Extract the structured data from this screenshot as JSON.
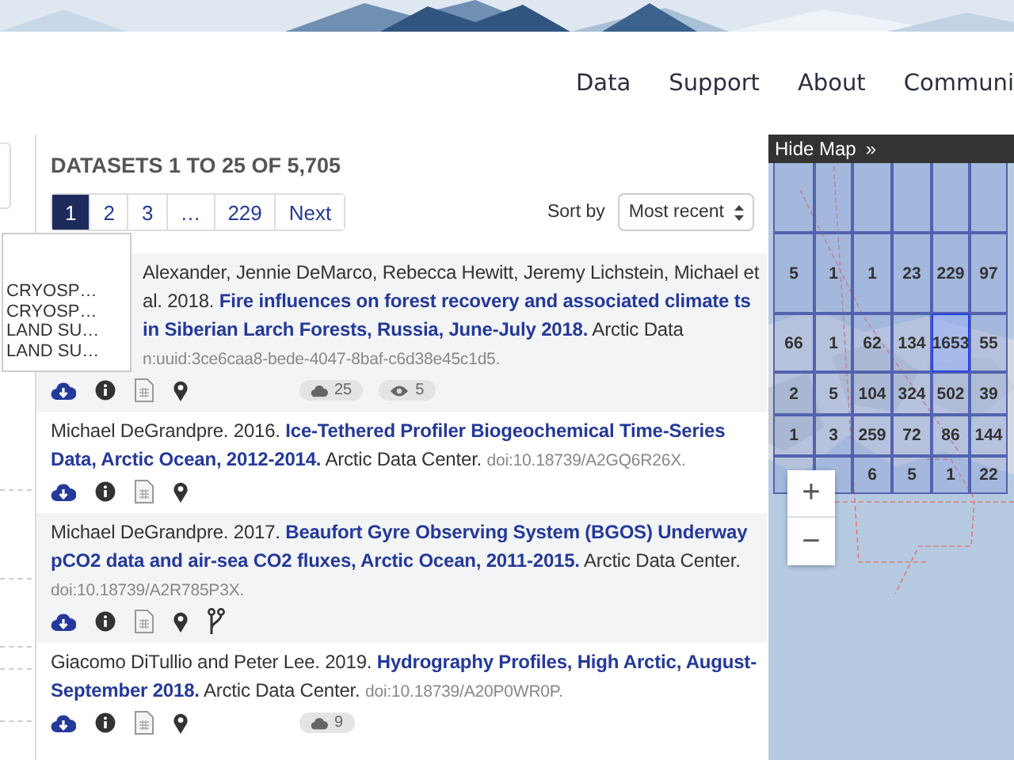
{
  "nav": {
    "items": [
      "Data",
      "Support",
      "About",
      "Communi"
    ]
  },
  "results": {
    "heading": "DATASETS 1 TO 25 OF 5,705",
    "pagination": [
      {
        "label": "1",
        "selected": true
      },
      {
        "label": "2",
        "selected": false
      },
      {
        "label": "3",
        "selected": false
      },
      {
        "label": "…",
        "selected": false
      },
      {
        "label": "229",
        "selected": false
      },
      {
        "label": "Next",
        "selected": false
      }
    ],
    "sort": {
      "label": "Sort by",
      "value": "Most recent"
    },
    "items": [
      {
        "citation": "Alexander, Jennie DeMarco, Rebecca Hewitt, Jeremy Lichstein, Michael et al. 2018. **Fire influences on forest recovery and associated climate ts in Siberian Larch Forests, Russia, June-July 2018.** Arctic Data",
        "id": "n:uuid:3ce6caa8-bede-4047-8baf-c6d38e45c1d5.",
        "partly_covered": true,
        "has_branch": false,
        "downloads": "25",
        "views": "5"
      },
      {
        "citation": "Michael DeGrandpre. 2016. **Ice-Tethered Profiler Biogeochemical Time-Series Data, Arctic Ocean, 2012-2014.** Arctic Data Center.",
        "id": "doi:10.18739/A2GQ6R26X.",
        "partly_covered": false,
        "has_branch": false
      },
      {
        "citation": "Michael DeGrandpre. 2017. **Beaufort Gyre Observing System (BGOS) Underway pCO2 data and air-sea CO2 fluxes, Arctic Ocean, 2011-2015.** Arctic Data Center.",
        "id": "doi:10.18739/A2R785P3X.",
        "partly_covered": false,
        "has_branch": true
      },
      {
        "citation": "Giacomo DiTullio and Peter Lee. 2019. **Hydrography Profiles, High Arctic, August-September 2018.** Arctic Data Center.",
        "id": "doi:10.18739/A20P0WR0P.",
        "partly_covered": false,
        "has_branch": false,
        "downloads": "9"
      }
    ]
  },
  "filter_popup": {
    "items": [
      "CRYOSP…",
      "CRYOSP…",
      "LAND SU…",
      "LAND SU…"
    ]
  },
  "map": {
    "toggle": "Hide Map",
    "toggle_icon": "»",
    "rows": [
      [
        {
          "count": "5",
          "selected": false
        },
        {
          "count": "1",
          "selected": false
        },
        {
          "count": "1",
          "selected": false
        },
        {
          "count": "23",
          "selected": false
        },
        {
          "count": "229",
          "selected": false
        },
        {
          "count": "97",
          "selected": false
        }
      ],
      [
        {
          "count": "66",
          "selected": false
        },
        {
          "count": "1",
          "selected": false
        },
        {
          "count": "62",
          "selected": false
        },
        {
          "count": "134",
          "selected": false
        },
        {
          "count": "1653",
          "selected": true
        },
        {
          "count": "55",
          "selected": false
        }
      ],
      [
        {
          "count": "2",
          "selected": false
        },
        {
          "count": "5",
          "selected": false
        },
        {
          "count": "104",
          "selected": false
        },
        {
          "count": "324",
          "selected": false
        },
        {
          "count": "502",
          "selected": false
        },
        {
          "count": "39",
          "selected": false
        }
      ],
      [
        {
          "count": "1",
          "selected": false
        },
        {
          "count": "3",
          "selected": false
        },
        {
          "count": "259",
          "selected": false
        },
        {
          "count": "72",
          "selected": false
        },
        {
          "count": "86",
          "selected": false
        },
        {
          "count": "144",
          "selected": false
        }
      ],
      [
        {
          "selected": false
        },
        {
          "selected": false
        },
        {
          "count": "6",
          "selected": false
        },
        {
          "count": "5",
          "selected": false
        },
        {
          "count": "1",
          "selected": false
        },
        {
          "count": "22",
          "selected": false
        }
      ]
    ],
    "zoom": [
      "+",
      "−"
    ]
  }
}
